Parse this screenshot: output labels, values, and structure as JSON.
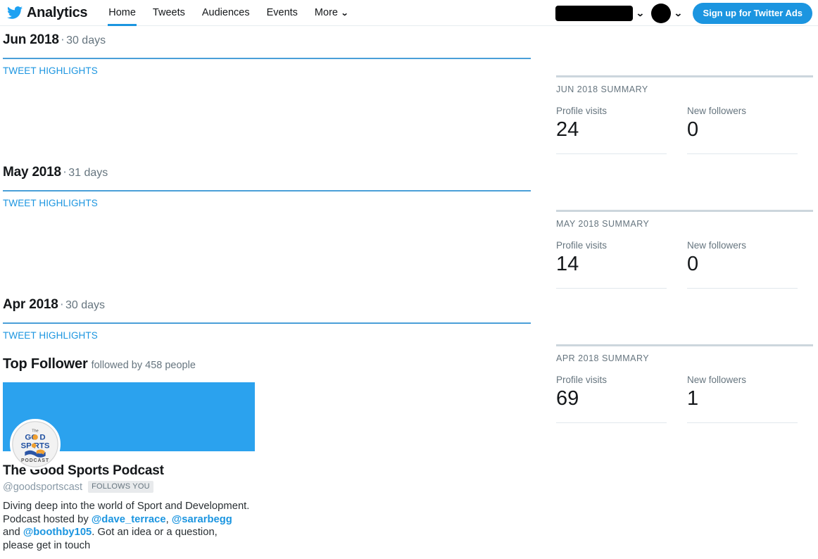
{
  "header": {
    "logo_icon": "twitter-bird-icon",
    "brand_title": "Analytics",
    "nav": [
      {
        "label": "Home",
        "active": true
      },
      {
        "label": "Tweets",
        "active": false
      },
      {
        "label": "Audiences",
        "active": false
      },
      {
        "label": "Events",
        "active": false
      },
      {
        "label": "More",
        "active": false,
        "caret": "⌄"
      }
    ],
    "account_menu_caret": "⌄",
    "avatar_menu_caret": "⌄",
    "ads_button_label": "Sign up for Twitter Ads",
    "accent_color": "#1b95e0"
  },
  "months": [
    {
      "name": "Jun 2018",
      "separator": "·",
      "days": "30 days",
      "highlights_label": "TWEET HIGHLIGHTS",
      "summary_title": "JUN 2018 SUMMARY",
      "stats": [
        {
          "label": "Profile visits",
          "value": "24"
        },
        {
          "label": "New followers",
          "value": "0"
        }
      ]
    },
    {
      "name": "May 2018",
      "separator": "·",
      "days": "31 days",
      "highlights_label": "TWEET HIGHLIGHTS",
      "summary_title": "MAY 2018 SUMMARY",
      "stats": [
        {
          "label": "Profile visits",
          "value": "14"
        },
        {
          "label": "New followers",
          "value": "0"
        }
      ]
    },
    {
      "name": "Apr 2018",
      "separator": "·",
      "days": "30 days",
      "highlights_label": "TWEET HIGHLIGHTS",
      "summary_title": "APR 2018 SUMMARY",
      "stats": [
        {
          "label": "Profile visits",
          "value": "69"
        },
        {
          "label": "New followers",
          "value": "1"
        }
      ]
    }
  ],
  "top_follower": {
    "title": "Top Follower",
    "subtitle": "followed by 458 people",
    "avatar_alt": "The Good Sports Podcast logo",
    "avatar_text_top": "The",
    "avatar_text_1": "GOOD",
    "avatar_text_2": "SPORTS",
    "avatar_text_3": "PODCAST",
    "name": "The Good Sports Podcast",
    "handle": "@goodsportscast",
    "badge": "FOLLOWS YOU",
    "bio_part_1": "Diving deep into the world of Sport and Development. Podcast hosted by ",
    "bio_mention_1": "@dave_terrace",
    "bio_part_2": ", ",
    "bio_mention_2": "@sararbegg",
    "bio_part_3": " and ",
    "bio_mention_3": "@boothby105",
    "bio_part_4": ". Got an idea or a question, please get in touch"
  }
}
